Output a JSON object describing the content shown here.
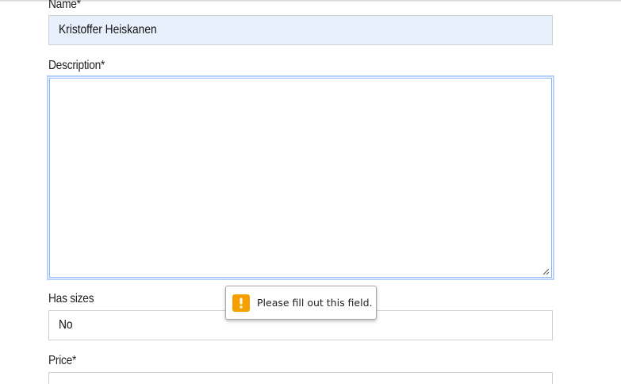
{
  "form": {
    "name": {
      "label": "Name*",
      "value": "Kristoffer Heiskanen",
      "autofilled": true
    },
    "description": {
      "label": "Description*",
      "value": ""
    },
    "has_sizes": {
      "label": "Has sizes",
      "value": "No"
    },
    "price": {
      "label": "Price*",
      "value": ""
    }
  },
  "validation_tooltip": {
    "message": "Please fill out this field.",
    "icon": "warning-icon",
    "icon_color": "#f5a000"
  },
  "colors": {
    "autofill_background": "#e8f0fe",
    "focus_ring": "#8ab4f8"
  }
}
